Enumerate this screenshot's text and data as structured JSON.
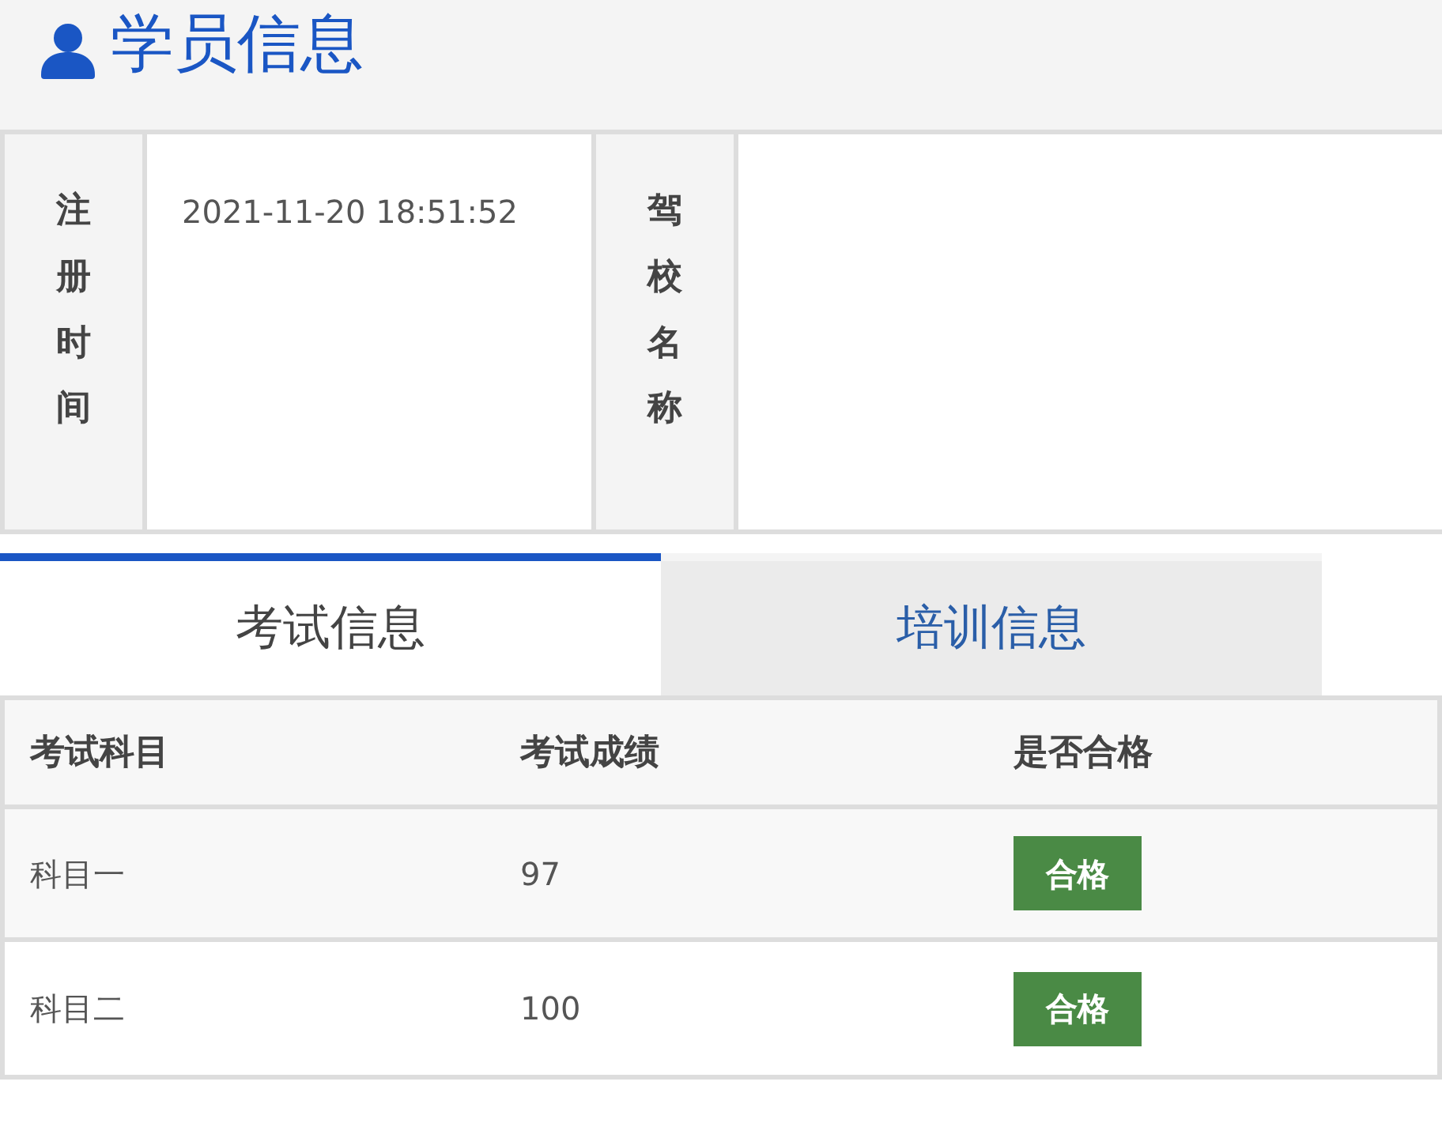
{
  "header": {
    "title": "学员信息"
  },
  "info": [
    {
      "label": "注册时间",
      "value": "2021-11-20 18:51:52"
    },
    {
      "label": "驾校名称"
    }
  ],
  "tabs": [
    {
      "label": "考试信息",
      "selected": true
    },
    {
      "label": "培训信息",
      "selected": false
    }
  ],
  "table": {
    "columns": [
      "考试科目",
      "考试成绩",
      "是否合格"
    ],
    "rows": [
      {
        "subject": "科目一",
        "score": "97",
        "result": {
          "text": "合格",
          "kind": "pass"
        }
      },
      {
        "subject": "科目二",
        "score": "100",
        "result": {
          "text": "合格",
          "kind": "pass"
        }
      }
    ]
  }
}
